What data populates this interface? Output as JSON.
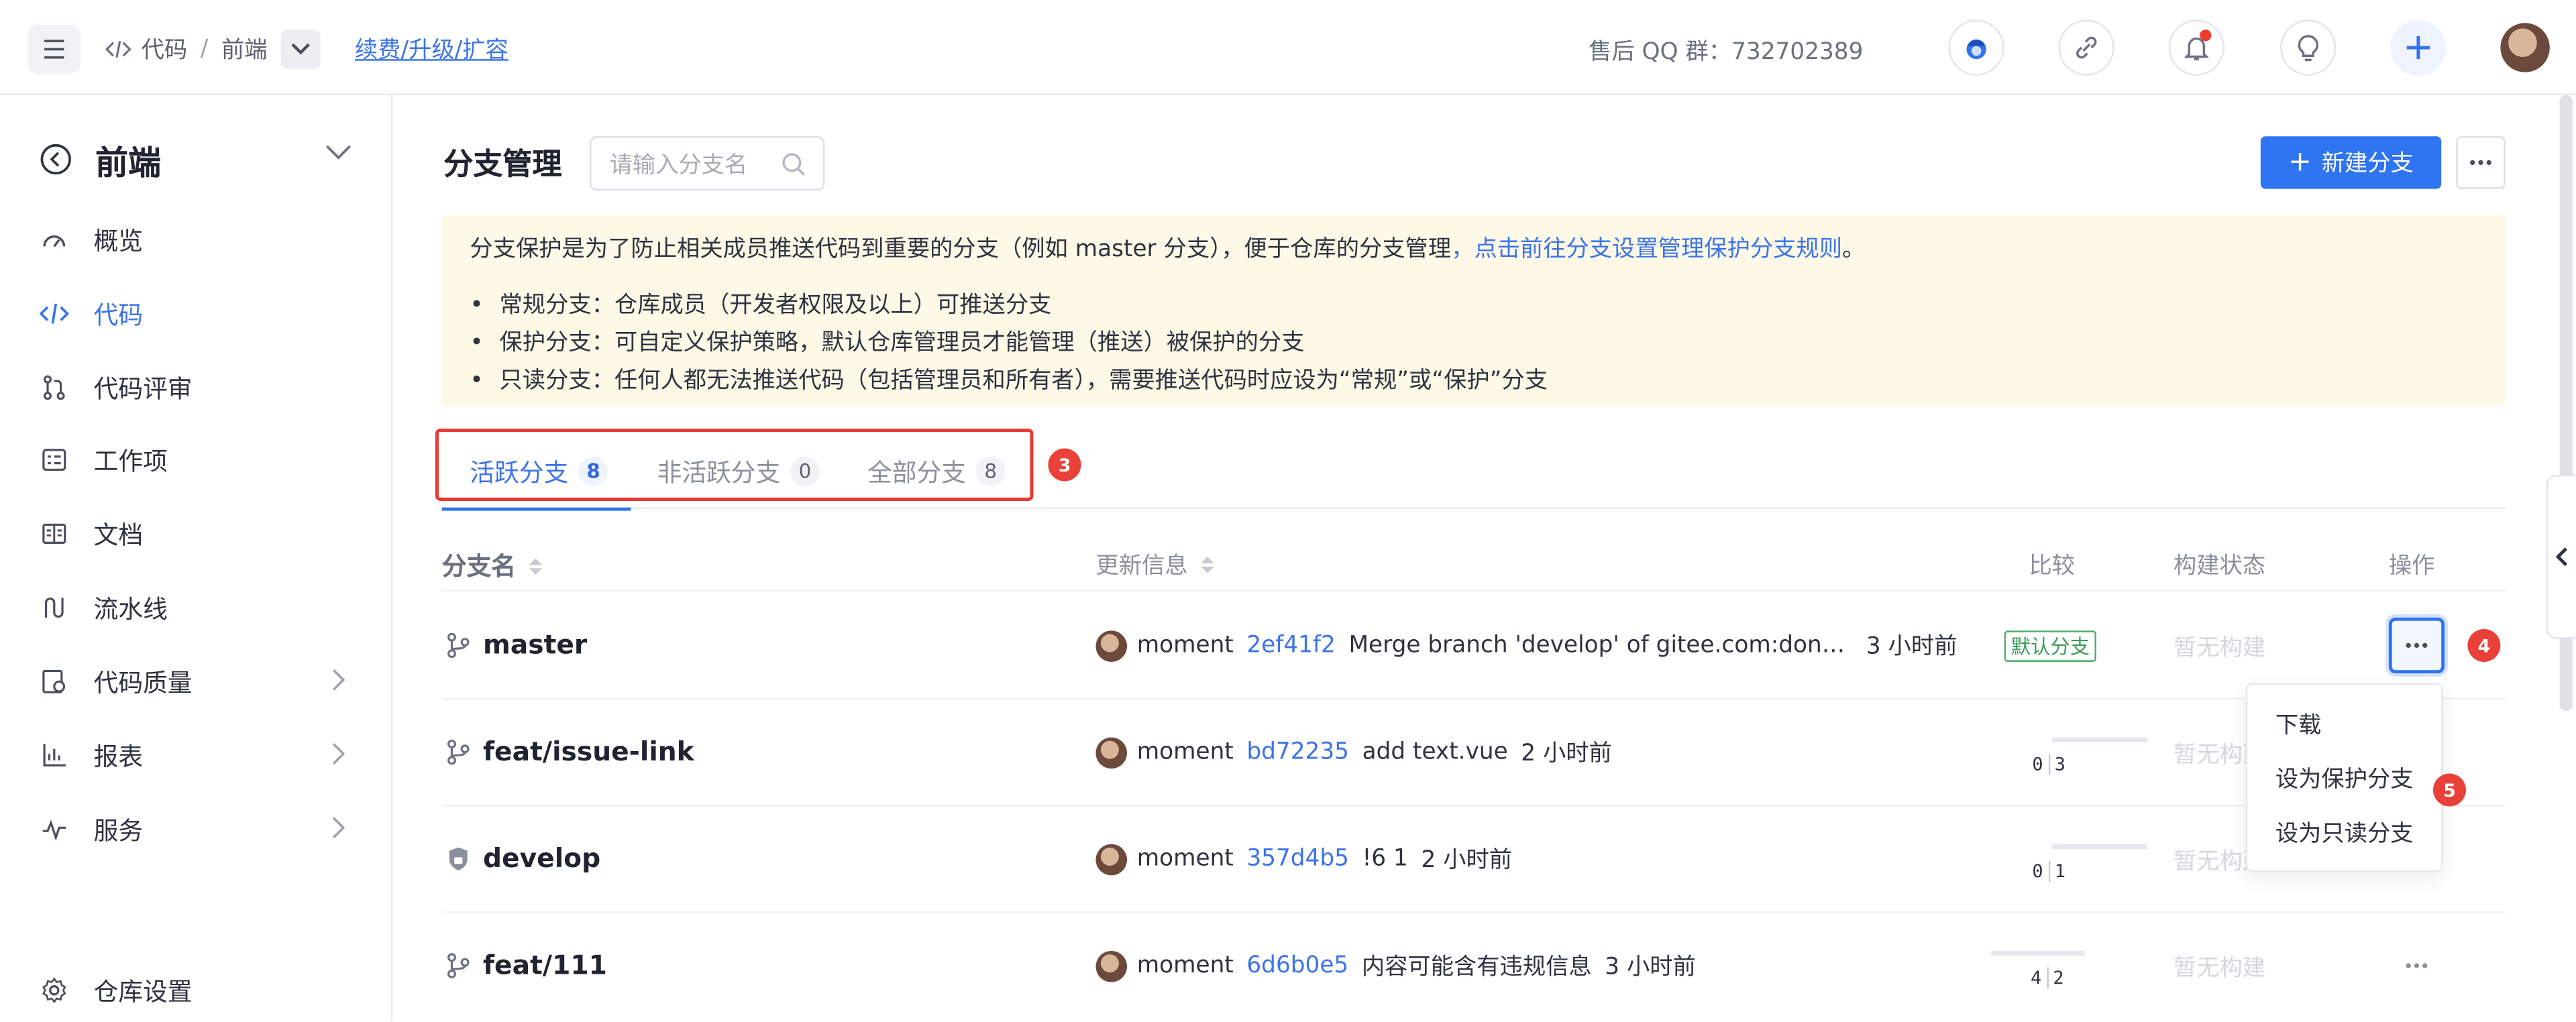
{
  "header": {
    "breadcrumb": [
      "代码",
      "前端"
    ],
    "breadcrumb_sep": "/",
    "renew_link": "续费/升级/扩容",
    "qq_group": "售后 QQ 群：732702389"
  },
  "sidebar": {
    "project_name": "前端",
    "items": [
      {
        "label": "概览",
        "icon": "dashboard-icon"
      },
      {
        "label": "代码",
        "icon": "code-icon",
        "active": true
      },
      {
        "label": "代码评审",
        "icon": "pull-request-icon"
      },
      {
        "label": "工作项",
        "icon": "task-icon"
      },
      {
        "label": "文档",
        "icon": "document-icon"
      },
      {
        "label": "流水线",
        "icon": "pipeline-icon"
      },
      {
        "label": "代码质量",
        "icon": "quality-icon",
        "expandable": true
      },
      {
        "label": "报表",
        "icon": "report-icon",
        "expandable": true
      },
      {
        "label": "服务",
        "icon": "service-icon",
        "expandable": true
      }
    ],
    "settings_label": "仓库设置"
  },
  "main": {
    "title": "分支管理",
    "search_placeholder": "请输入分支名",
    "new_branch_label": "新建分支",
    "notice": {
      "lead": "分支保护是为了防止相关成员推送代码到重要的分支（例如 master 分支），便于仓库的分支管理",
      "link": "，点击前往分支设置管理保护分支规则",
      "period": "。",
      "bullets": [
        "常规分支：仓库成员（开发者权限及以上）可推送分支",
        "保护分支：可自定义保护策略，默认仓库管理员才能管理（推送）被保护的分支",
        "只读分支：任何人都无法推送代码（包括管理员和所有者），需要推送代码时应设为“常规”或“保护”分支"
      ]
    },
    "tabs": [
      {
        "label": "活跃分支",
        "count": "8",
        "active": true
      },
      {
        "label": "非活跃分支",
        "count": "0"
      },
      {
        "label": "全部分支",
        "count": "8"
      }
    ],
    "columns": {
      "name": "分支名",
      "update": "更新信息",
      "compare": "比较",
      "build": "构建状态",
      "ops": "操作"
    },
    "rows": [
      {
        "name": "master",
        "icon": "branch-icon",
        "author": "moment",
        "sha": "2ef41f2",
        "message": "Merge branch 'develop' of gitee.com:dont-engage/frontend into master",
        "time": "3 小时前",
        "compare_tag": "默认分支",
        "build": "暂无构建"
      },
      {
        "name": "feat/issue-link",
        "icon": "branch-icon",
        "author": "moment",
        "sha": "bd72235",
        "message": "add text.vue",
        "time": "2 小时前",
        "behind": "0",
        "ahead": "3",
        "build": "暂无构建"
      },
      {
        "name": "develop",
        "icon": "shield-icon",
        "author": "moment",
        "sha": "357d4b5",
        "message": "!6 1",
        "time": "2 小时前",
        "behind": "0",
        "ahead": "1",
        "build": "暂无构建"
      },
      {
        "name": "feat/111",
        "icon": "branch-icon",
        "author": "moment",
        "sha": "6d6b0e5",
        "message": "内容可能含有违规信息",
        "time": "3 小时前",
        "behind": "4",
        "ahead": "2",
        "build": "暂无构建"
      }
    ],
    "dropdown": [
      "下载",
      "设为保护分支",
      "设为只读分支"
    ]
  },
  "callouts": [
    "3",
    "4",
    "5"
  ],
  "colors": {
    "accent": "#2f74f0",
    "link": "#3b74e8",
    "notice_bg": "#fef8e6",
    "callout": "#e9403a",
    "default_tag": "#3a9a57"
  }
}
